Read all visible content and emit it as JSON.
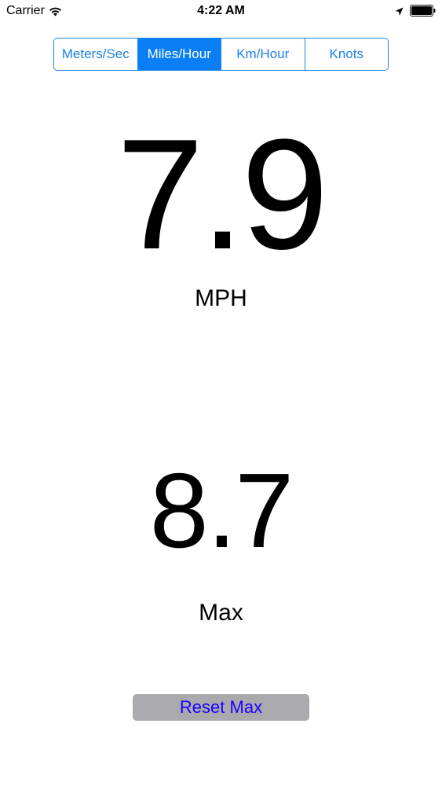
{
  "status_bar": {
    "carrier": "Carrier",
    "time": "4:22 AM",
    "icons": [
      "wifi-icon",
      "location-arrow-icon",
      "battery-icon"
    ]
  },
  "units": {
    "segments": [
      "Meters/Sec",
      "Miles/Hour",
      "Km/Hour",
      "Knots"
    ],
    "selected": "Miles/Hour"
  },
  "speed": {
    "value": "7.9",
    "unit": "MPH"
  },
  "max": {
    "value": "8.7",
    "label": "Max"
  },
  "reset_button": {
    "label": "Reset Max"
  },
  "colors": {
    "accent": "#0a7ff5",
    "button_bg": "#aaa9ae",
    "button_text": "#1a00ff"
  }
}
